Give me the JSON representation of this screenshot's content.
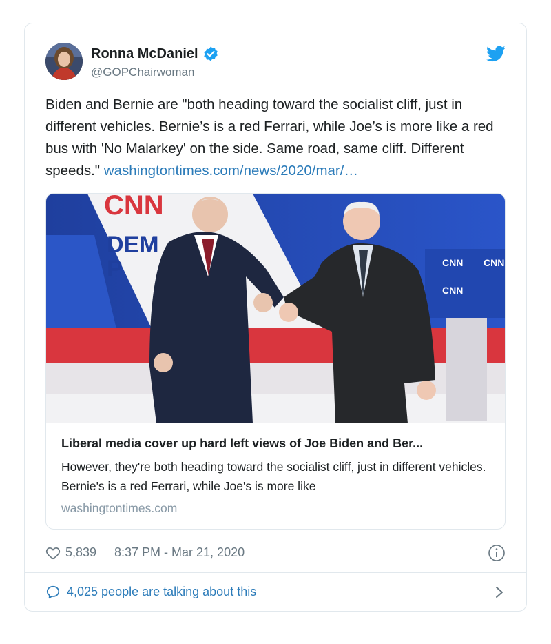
{
  "author": {
    "display_name": "Ronna McDaniel",
    "handle": "@GOPChairwoman",
    "verified": true
  },
  "tweet": {
    "text": "Biden and Bernie are \"both heading toward the socialist cliff, just in different vehicles. Bernie’s is a red Ferrari, while Joe’s is more like a red bus with 'No Malarkey' on the side. Same road, same cliff. Different speeds.\" ",
    "link_text": "washingtontimes.com/news/2020/mar/…"
  },
  "card": {
    "image_alt": "CNN",
    "title": "Liberal media cover up hard left views of Joe Biden and Ber...",
    "description": "However, they're both heading toward the socialist cliff, just in different vehicles. Bernie's is a red Ferrari, while Joe's is more like",
    "domain": "washingtontimes.com"
  },
  "meta": {
    "like_count": "5,839",
    "timestamp": "8:37 PM - Mar 21, 2020"
  },
  "conversation": {
    "text": "4,025 people are talking about this"
  },
  "colors": {
    "link_blue": "#2b7bb9",
    "verified_blue": "#1da1f2",
    "muted_gray": "#697882"
  }
}
